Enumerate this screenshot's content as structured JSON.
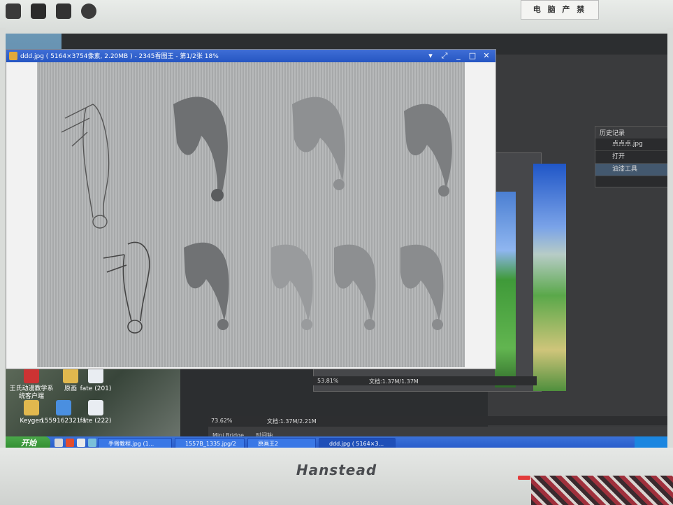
{
  "sticker": {
    "text": "电 脑 产 禁"
  },
  "monitor": {
    "brand": "Hanstead"
  },
  "viewer": {
    "title": "ddd.jpg ( 5164×3754像素, 2.20MB ) - 2345看图王 - 第1/2张 18%",
    "buttons": [
      "▾",
      "⤢",
      "_",
      "□",
      "✕"
    ]
  },
  "desktop": {
    "icons": [
      {
        "label": "王氏动漫教学系统客户端",
        "color": "#c33"
      },
      {
        "label": "原画",
        "color": "#e1b84e"
      },
      {
        "label": "fate (201)",
        "color": "#e9edf2"
      },
      {
        "label": "Keygen",
        "color": "#e1b84e"
      },
      {
        "label": "1559162321 1",
        "color": "#4a8fe0"
      },
      {
        "label": "fate (222)",
        "color": "#e9edf2"
      }
    ]
  },
  "photoshop": {
    "history_title": "历史记录",
    "history_items": [
      "点点点.jpg",
      "打开",
      "油漆工具"
    ],
    "status_doc1_zoom": "53.81%",
    "status_doc1_info": "文档:1.37M/1.37M",
    "status_doc2_zoom": "73.62%",
    "status_doc2_info": "文档:1.37M/2.21M",
    "bridge_tabs": [
      "Mini Bridge",
      "时间轴"
    ]
  },
  "taskbar": {
    "start_label": "开始",
    "tasks": [
      {
        "label": "手臂教程.jpg (1...",
        "active": false
      },
      {
        "label": "1557B_1335.jpg/2",
        "active": false
      },
      {
        "label": "原画王2",
        "active": false
      },
      {
        "label": "ddd.jpg ( 5164×3...",
        "active": true
      }
    ]
  }
}
